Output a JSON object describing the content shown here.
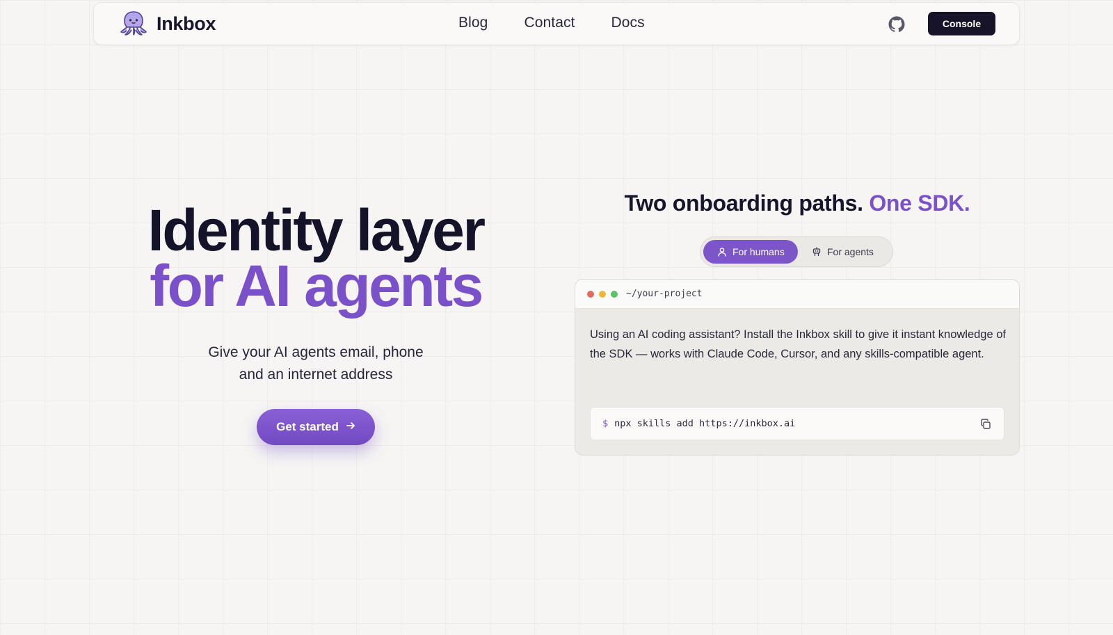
{
  "nav": {
    "brand": "Inkbox",
    "logo_icon": "octopus-logo-icon",
    "links": [
      {
        "label": "Blog"
      },
      {
        "label": "Contact"
      },
      {
        "label": "Docs"
      }
    ],
    "github_icon": "github-icon",
    "console_label": "Console"
  },
  "hero": {
    "title_line1": "Identity layer",
    "title_line2": "for AI agents",
    "subtitle_line1": "Give your AI agents email, phone",
    "subtitle_line2": "and an internet address",
    "cta_label": "Get started",
    "cta_icon": "arrow-right-icon"
  },
  "onboarding": {
    "title_main": "Two onboarding paths.",
    "title_accent": "One SDK.",
    "toggle": {
      "humans_label": "For humans",
      "agents_label": "For agents",
      "selected": "For humans"
    },
    "terminal": {
      "path": "~/your-project",
      "description": "Using an AI coding assistant? Install the Inkbox skill to give it instant knowledge of the SDK — works with Claude Code, Cursor, and any skills-compatible agent.",
      "prompt": "$",
      "command": "npx skills add https://inkbox.ai",
      "copy_icon": "copy-icon"
    }
  },
  "colors": {
    "accent": "#7a51c8",
    "dark": "#17152b",
    "background": "#f6f5f3"
  }
}
